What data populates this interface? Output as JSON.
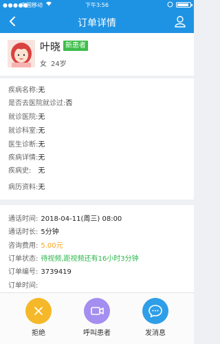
{
  "statusbar": {
    "signal": "●●●●●",
    "carrier": "中国移动",
    "time": "下午3:56"
  },
  "header": {
    "title": "订单详情"
  },
  "patient": {
    "name": "叶晓",
    "badge": "新患者",
    "gender": "女",
    "age": "24岁"
  },
  "details": [
    {
      "label": "疾病名称:",
      "value": "无"
    },
    {
      "label": "是否去医院就诊过:",
      "value": "否"
    },
    {
      "label": "就诊医院:",
      "value": "无"
    },
    {
      "label": "就诊科室:",
      "value": "无"
    },
    {
      "label": "医生诊断:",
      "value": "无"
    },
    {
      "label": "疾病详情:",
      "value": "无"
    },
    {
      "label": "疾病史:",
      "value": "无"
    },
    {
      "label": "病历资料:",
      "value": "无"
    }
  ],
  "order": [
    {
      "label": "通话时间:",
      "value": "2018-04-11(周三) 08:00"
    },
    {
      "label": "通话时长:",
      "value": "5分钟"
    },
    {
      "label": "咨询费用:",
      "value": "5.00元"
    },
    {
      "label": "订单状态:",
      "value": "待视频,距视频还有16小时3分钟"
    },
    {
      "label": "订单编号:",
      "value": "3739419"
    },
    {
      "label": "订单时间:",
      "value": ""
    }
  ],
  "actions": {
    "reject": "拒绝",
    "call": "呼叫患者",
    "message": "发消息"
  },
  "colors": {
    "primary": "#1f93e3",
    "reject": "#f5b829",
    "call": "#a48ef0",
    "message": "#2f9ee8",
    "fee": "#f5a623",
    "status": "#2bb74a",
    "badge": "#3ebd4a"
  }
}
